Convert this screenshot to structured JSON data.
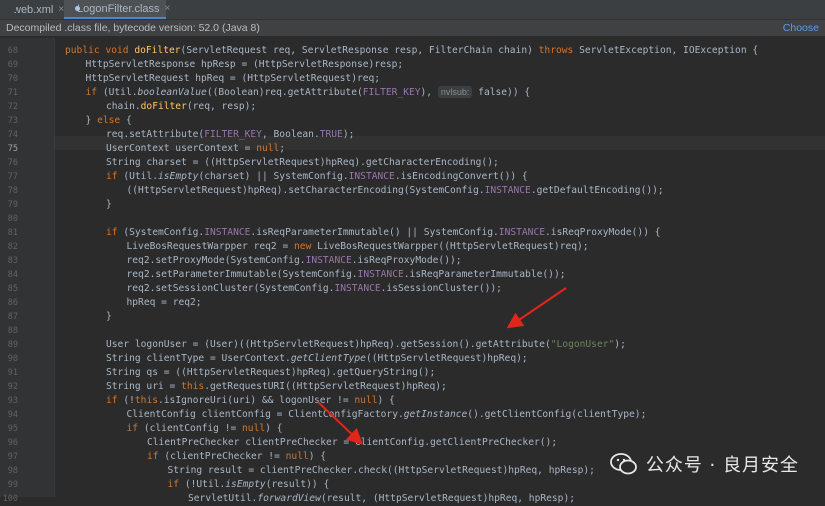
{
  "tabs": [
    {
      "label": "web.xml",
      "close": "×"
    },
    {
      "label": "LogonFilter.class",
      "close": "×"
    }
  ],
  "notice": {
    "text": "Decompiled .class file, bytecode version: 52.0 (Java 8)",
    "action": "Choose"
  },
  "editor": {
    "lines": [
      {
        "n": "68",
        "code": "public void doFilter(ServletRequest req, ServletResponse resp, FilterChain chain) throws ServletException, IOException {"
      },
      {
        "n": "69",
        "code": "HttpServletResponse hpResp = (HttpServletResponse)resp;"
      },
      {
        "n": "70",
        "code": "HttpServletRequest hpReq = (HttpServletRequest)req;"
      },
      {
        "n": "71",
        "code_a": "if (Util.booleanValue((Boolean)req.getAttribute(FILTER_KEY), ",
        "hint": "nvlsub:",
        "code_b": " false)) {"
      },
      {
        "n": "72",
        "code": "chain.doFilter(req, resp);"
      },
      {
        "n": "73",
        "code": "} else {"
      },
      {
        "n": "74",
        "code": "req.setAttribute(FILTER_KEY, Boolean.TRUE);"
      },
      {
        "n": "75",
        "code": "UserContext userContext = null;"
      },
      {
        "n": "76",
        "code": "String charset = ((HttpServletRequest)hpReq).getCharacterEncoding();"
      },
      {
        "n": "77",
        "code": "if (Util.isEmpty(charset) || SystemConfig.INSTANCE.isEncodingConvert()) {"
      },
      {
        "n": "78",
        "code": "((HttpServletRequest)hpReq).setCharacterEncoding(SystemConfig.INSTANCE.getDefaultEncoding());"
      },
      {
        "n": "79",
        "code": "}"
      },
      {
        "n": "80",
        "code": ""
      },
      {
        "n": "81",
        "code": "if (SystemConfig.INSTANCE.isReqParameterImmutable() || SystemConfig.INSTANCE.isReqProxyMode()) {"
      },
      {
        "n": "82",
        "code": "LiveBosRequestWarpper req2 = new LiveBosRequestWarpper((HttpServletRequest)req);"
      },
      {
        "n": "83",
        "code": "req2.setProxyMode(SystemConfig.INSTANCE.isReqProxyMode());"
      },
      {
        "n": "84",
        "code": "req2.setParameterImmutable(SystemConfig.INSTANCE.isReqParameterImmutable());"
      },
      {
        "n": "85",
        "code": "req2.setSessionCluster(SystemConfig.INSTANCE.isSessionCluster());"
      },
      {
        "n": "86",
        "code": "hpReq = req2;"
      },
      {
        "n": "87",
        "code": "}"
      },
      {
        "n": "88",
        "code": ""
      },
      {
        "n": "89",
        "code": "User logonUser = (User)((HttpServletRequest)hpReq).getSession().getAttribute(\"LogonUser\");"
      },
      {
        "n": "90",
        "code": "String clientType = UserContext.getClientType((HttpServletRequest)hpReq);"
      },
      {
        "n": "91",
        "code": "String qs = ((HttpServletRequest)hpReq).getQueryString();"
      },
      {
        "n": "92",
        "code": "String uri = this.getRequestURI((HttpServletRequest)hpReq);"
      },
      {
        "n": "93",
        "code": "if (!this.isIgnoreUri(uri) && logonUser != null) {"
      },
      {
        "n": "94",
        "code": "ClientConfig clientConfig = ClientConfigFactory.getInstance().getClientConfig(clientType);"
      },
      {
        "n": "95",
        "code": "if (clientConfig != null) {"
      },
      {
        "n": "96",
        "code": "ClientPreChecker clientPreChecker = clientConfig.getClientPreChecker();"
      },
      {
        "n": "97",
        "code": "if (clientPreChecker != null) {"
      },
      {
        "n": "98",
        "code": "String result = clientPreChecker.check((HttpServletRequest)hpReq, hpResp);"
      },
      {
        "n": "99",
        "code": "if (!Util.isEmpty(result)) {"
      },
      {
        "n": "100",
        "code": "ServletUtil.forwardView(result, (HttpServletRequest)hpReq, hpResp);"
      }
    ]
  },
  "watermark": {
    "text": "公众号 · 良月安全",
    "icon": "wechat-icon"
  },
  "colors": {
    "background": "#2b2b2b",
    "keyword": "#cc7832",
    "field": "#9876aa",
    "string": "#6a8759",
    "method": "#ffc66d",
    "arrow": "#e0261b"
  }
}
